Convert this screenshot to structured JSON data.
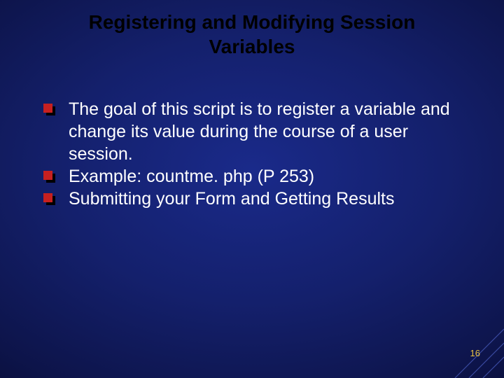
{
  "title": "Registering and Modifying Session Variables",
  "bullets": [
    "The goal of this script is to register a variable and change its value during the course of a user session.",
    "Example:    countme. php (P 253)",
    "Submitting your Form and Getting Results"
  ],
  "page_number": "16"
}
